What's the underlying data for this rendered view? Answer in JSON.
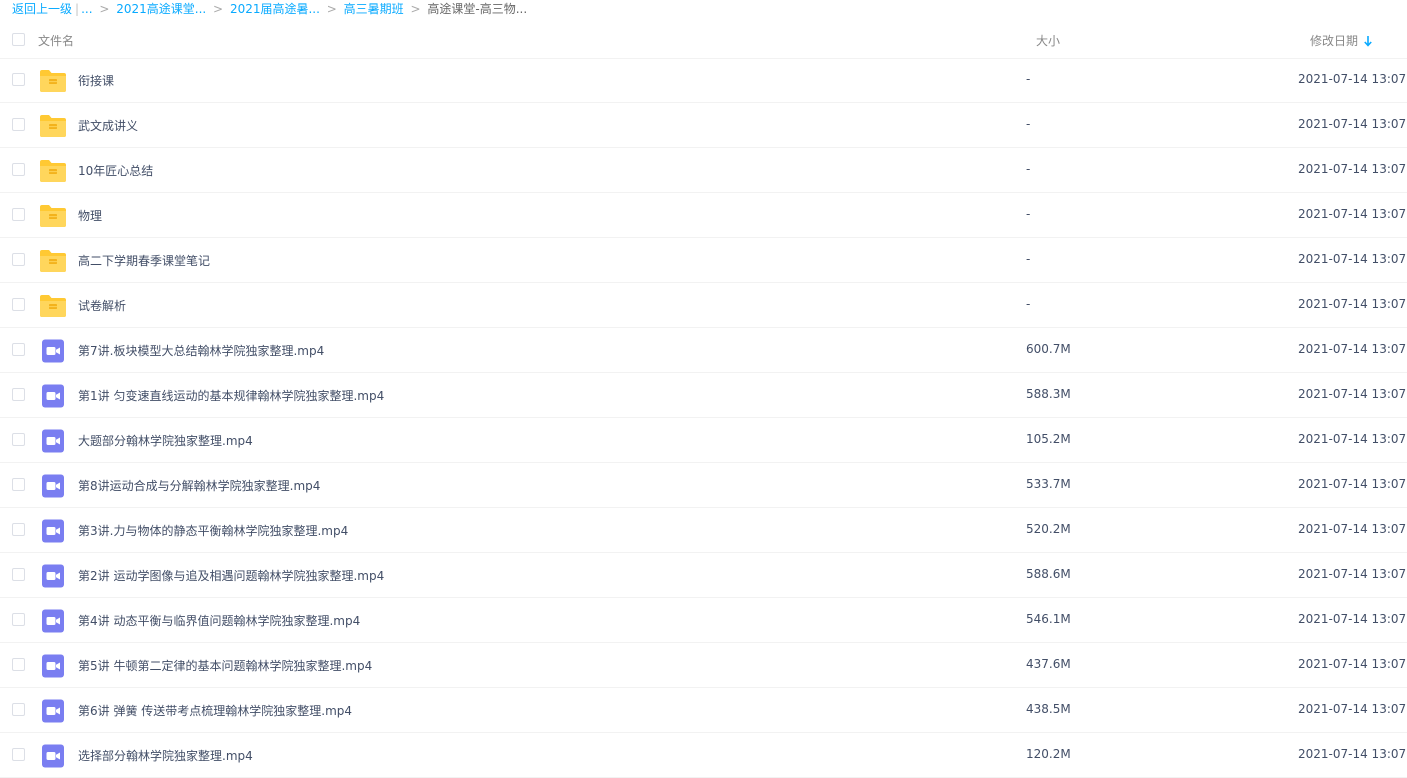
{
  "breadcrumb": {
    "back": "返回上一级",
    "ellipsis": "...",
    "items": [
      "2021高途课堂...",
      "2021届高途暑...",
      "高三暑期班"
    ],
    "current": "高途课堂-高三物..."
  },
  "header": {
    "name": "文件名",
    "size": "大小",
    "date": "修改日期"
  },
  "colors": {
    "accent": "#09aaff",
    "folder": "#ffd24d",
    "video": "#7a7ef1"
  },
  "files": [
    {
      "name": "衔接课",
      "size": "-",
      "date": "2021-07-14 13:07",
      "type": "folder"
    },
    {
      "name": "武文成讲义",
      "size": "-",
      "date": "2021-07-14 13:07",
      "type": "folder"
    },
    {
      "name": "10年匠心总结",
      "size": "-",
      "date": "2021-07-14 13:07",
      "type": "folder"
    },
    {
      "name": "物理",
      "size": "-",
      "date": "2021-07-14 13:07",
      "type": "folder"
    },
    {
      "name": "高二下学期春季课堂笔记",
      "size": "-",
      "date": "2021-07-14 13:07",
      "type": "folder"
    },
    {
      "name": "试卷解析",
      "size": "-",
      "date": "2021-07-14 13:07",
      "type": "folder"
    },
    {
      "name": "第7讲.板块模型大总结翰林学院独家整理.mp4",
      "size": "600.7M",
      "date": "2021-07-14 13:07",
      "type": "video"
    },
    {
      "name": "第1讲 匀变速直线运动的基本规律翰林学院独家整理.mp4",
      "size": "588.3M",
      "date": "2021-07-14 13:07",
      "type": "video"
    },
    {
      "name": "大题部分翰林学院独家整理.mp4",
      "size": "105.2M",
      "date": "2021-07-14 13:07",
      "type": "video"
    },
    {
      "name": "第8讲运动合成与分解翰林学院独家整理.mp4",
      "size": "533.7M",
      "date": "2021-07-14 13:07",
      "type": "video"
    },
    {
      "name": "第3讲.力与物体的静态平衡翰林学院独家整理.mp4",
      "size": "520.2M",
      "date": "2021-07-14 13:07",
      "type": "video"
    },
    {
      "name": "第2讲 运动学图像与追及相遇问题翰林学院独家整理.mp4",
      "size": "588.6M",
      "date": "2021-07-14 13:07",
      "type": "video"
    },
    {
      "name": "第4讲 动态平衡与临界值问题翰林学院独家整理.mp4",
      "size": "546.1M",
      "date": "2021-07-14 13:07",
      "type": "video"
    },
    {
      "name": "第5讲 牛顿第二定律的基本问题翰林学院独家整理.mp4",
      "size": "437.6M",
      "date": "2021-07-14 13:07",
      "type": "video"
    },
    {
      "name": "第6讲 弹簧 传送带考点梳理翰林学院独家整理.mp4",
      "size": "438.5M",
      "date": "2021-07-14 13:07",
      "type": "video"
    },
    {
      "name": "选择部分翰林学院独家整理.mp4",
      "size": "120.2M",
      "date": "2021-07-14 13:07",
      "type": "video"
    }
  ]
}
